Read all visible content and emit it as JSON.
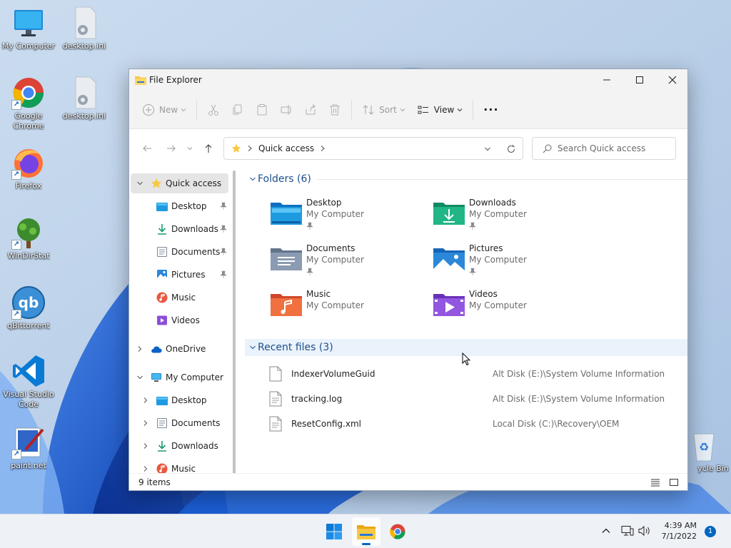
{
  "desktop": {
    "icons": [
      {
        "label": "My Computer",
        "icon": "monitor-icon"
      },
      {
        "label": "desktop.ini",
        "icon": "settings-file-icon"
      },
      {
        "label": "Google Chrome",
        "icon": "chrome-icon"
      },
      {
        "label": "desktop.ini",
        "icon": "settings-file-icon"
      },
      {
        "label": "Firefox",
        "icon": "firefox-icon"
      },
      {
        "label": "WinDirStat",
        "icon": "tree-icon"
      },
      {
        "label": "qBittorrent",
        "icon": "qbittorrent-icon"
      },
      {
        "label": "Visual Studio Code",
        "icon": "vscode-icon"
      },
      {
        "label": "paint.net",
        "icon": "paintnet-icon"
      },
      {
        "label": "ycle Bin",
        "icon": "recycle-bin-icon"
      }
    ]
  },
  "window": {
    "title": "File Explorer",
    "toolbar": {
      "new_label": "New",
      "sort_label": "Sort",
      "view_label": "View",
      "more_label": "···"
    },
    "address": {
      "crumb": "Quick access"
    },
    "search": {
      "placeholder": "Search Quick access"
    },
    "nav": [
      {
        "label": "Quick access",
        "icon": "star-icon"
      },
      {
        "label": "Desktop",
        "icon": "desktop-folder-icon"
      },
      {
        "label": "Downloads",
        "icon": "download-icon"
      },
      {
        "label": "Documents",
        "icon": "documents-icon"
      },
      {
        "label": "Pictures",
        "icon": "pictures-icon"
      },
      {
        "label": "Music",
        "icon": "music-icon"
      },
      {
        "label": "Videos",
        "icon": "videos-icon"
      },
      {
        "label": "OneDrive",
        "icon": "cloud-icon"
      },
      {
        "label": "My Computer",
        "icon": "computer-icon"
      },
      {
        "label": "Desktop",
        "icon": "desktop-folder-icon"
      },
      {
        "label": "Documents",
        "icon": "documents-icon"
      },
      {
        "label": "Downloads",
        "icon": "download-icon"
      },
      {
        "label": "Music",
        "icon": "music-icon"
      }
    ],
    "folders_header": "Folders (6)",
    "folders": [
      {
        "name": "Desktop",
        "location": "My Computer",
        "pinned": true
      },
      {
        "name": "Downloads",
        "location": "My Computer",
        "pinned": true
      },
      {
        "name": "Documents",
        "location": "My Computer",
        "pinned": true
      },
      {
        "name": "Pictures",
        "location": "My Computer",
        "pinned": true
      },
      {
        "name": "Music",
        "location": "My Computer",
        "pinned": false
      },
      {
        "name": "Videos",
        "location": "My Computer",
        "pinned": false
      }
    ],
    "recent_header": "Recent files (3)",
    "recent": [
      {
        "name": "IndexerVolumeGuid",
        "path": "Alt Disk (E:)\\System Volume Information"
      },
      {
        "name": "tracking.log",
        "path": "Alt Disk (E:)\\System Volume Information"
      },
      {
        "name": "ResetConfig.xml",
        "path": "Local Disk (C:)\\Recovery\\OEM"
      }
    ],
    "status": {
      "count": "9 items"
    }
  },
  "taskbar": {
    "time": "4:39 AM",
    "date": "7/1/2022",
    "notifications": "1"
  },
  "colors": {
    "accent": "#0067c0",
    "section_header": "#1b4f8c",
    "folder_yellow": "#f8c843"
  }
}
